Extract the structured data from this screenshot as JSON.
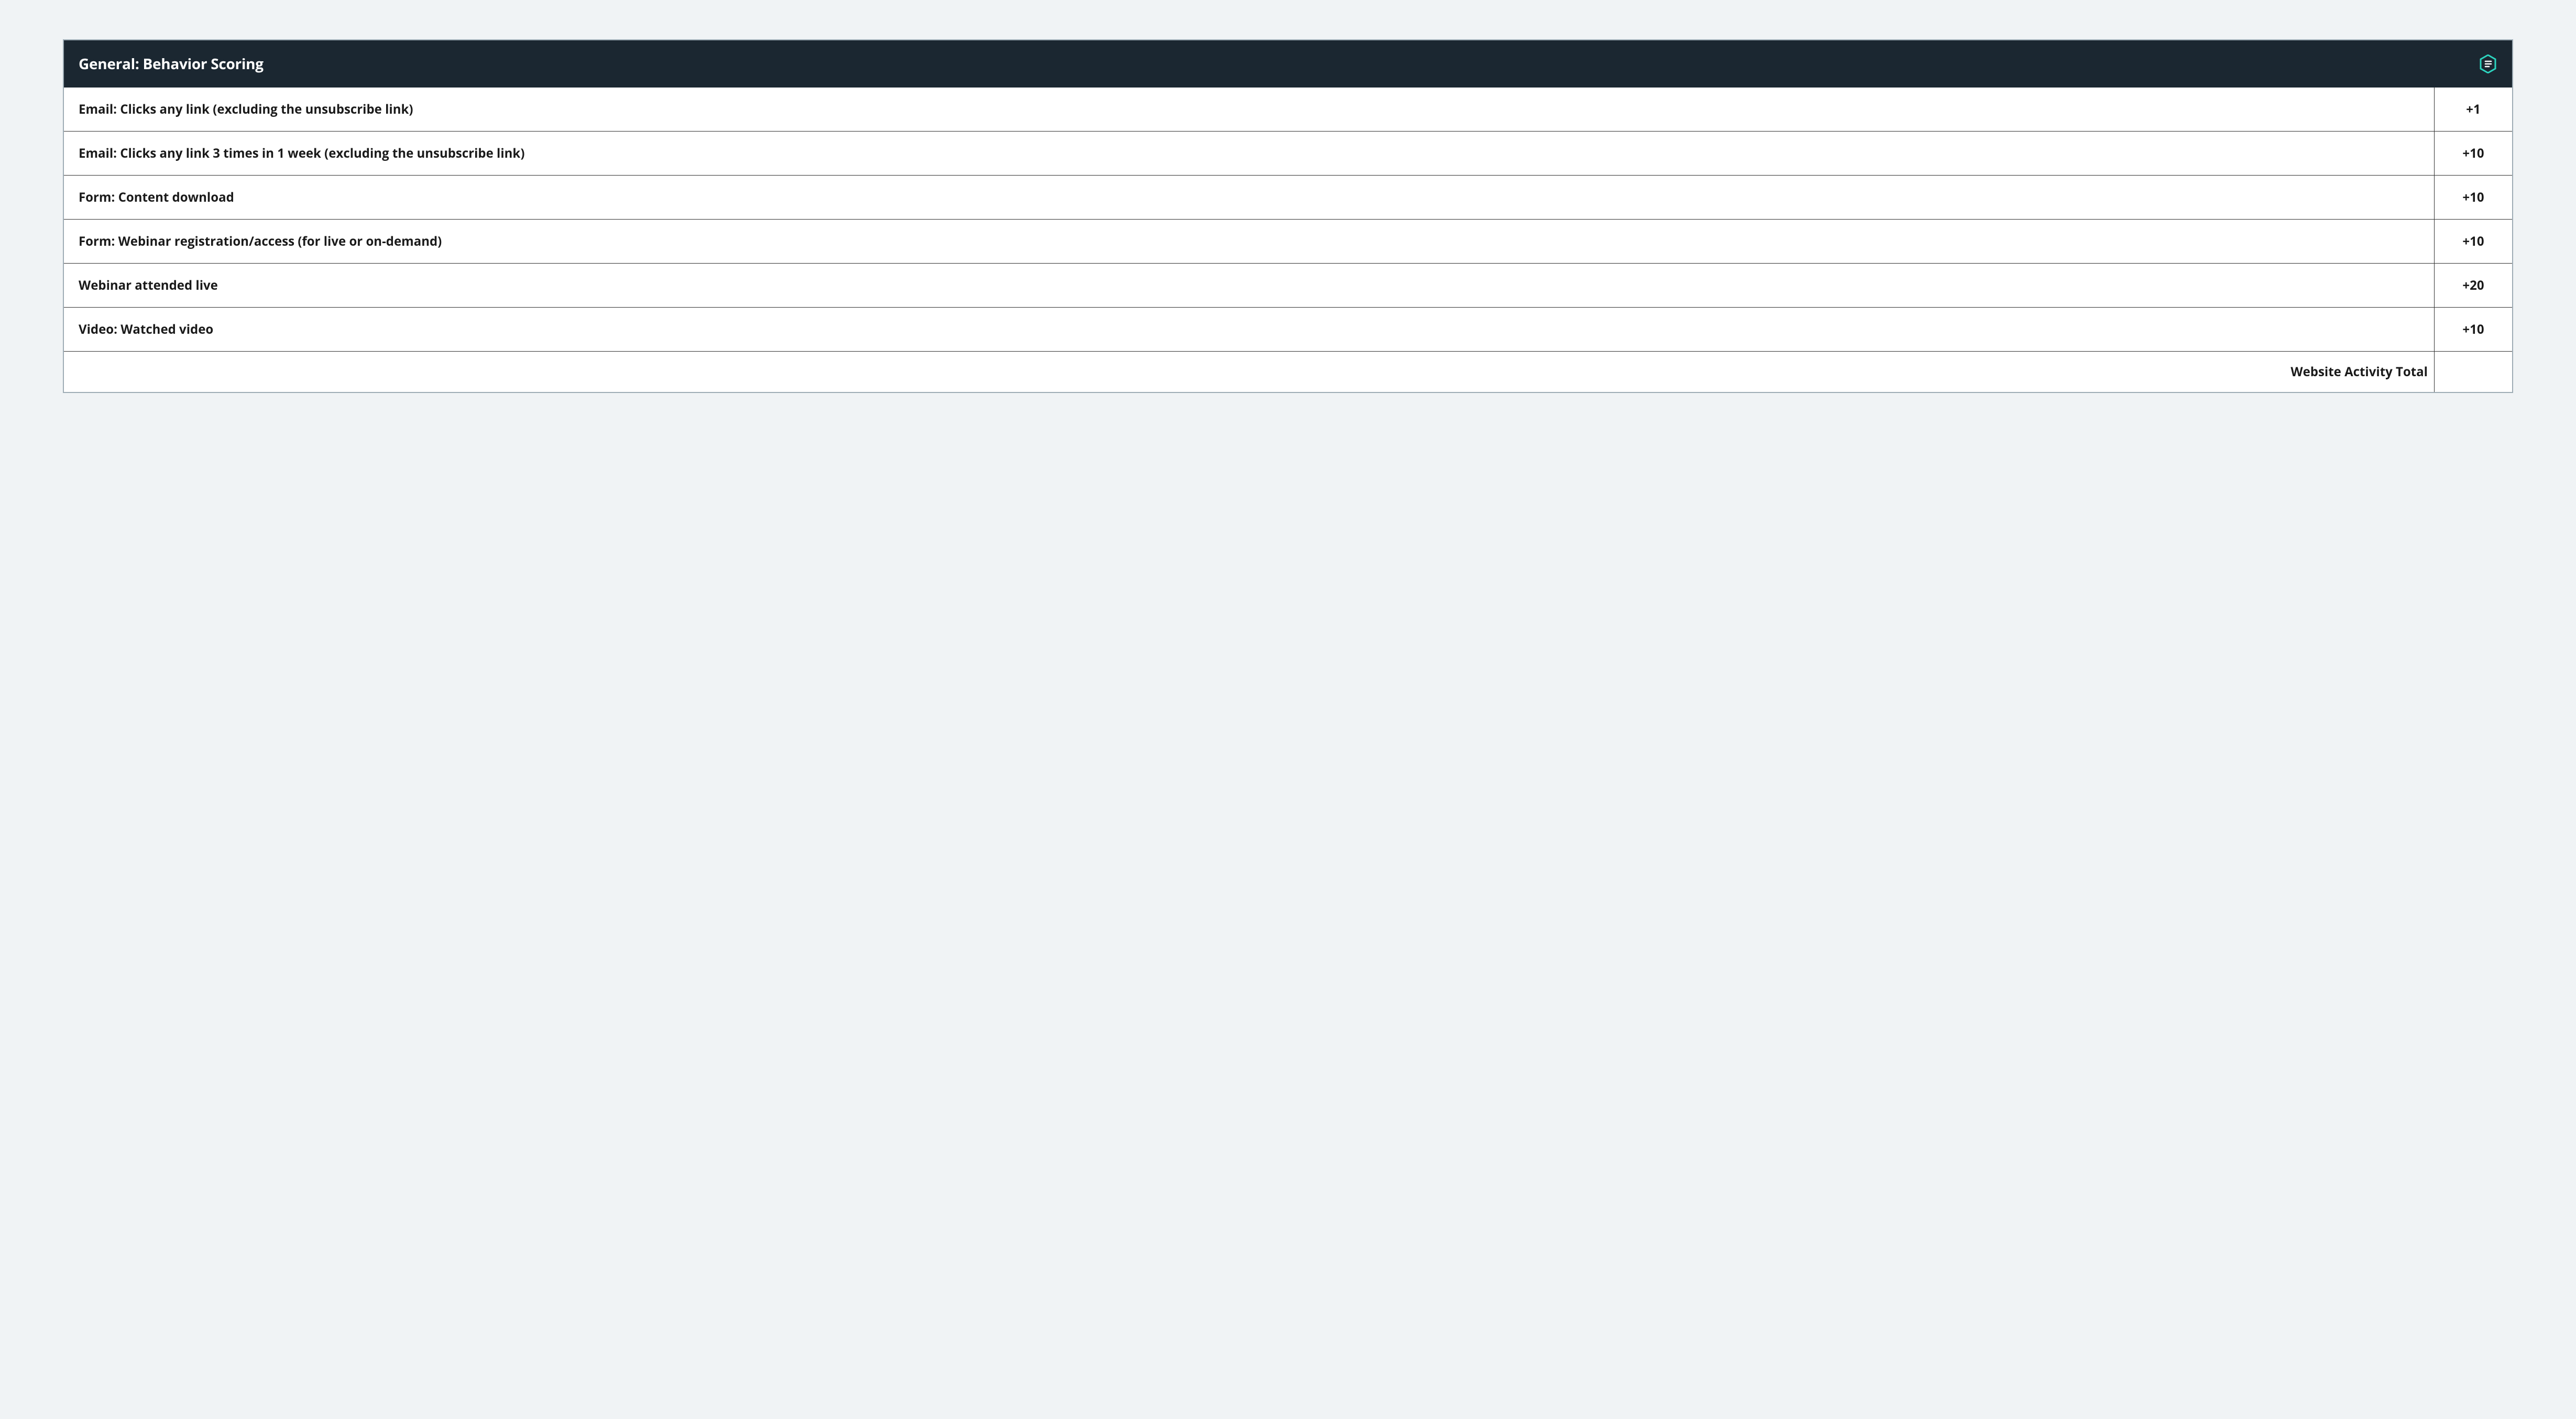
{
  "header": {
    "title": "General: Behavior Scoring"
  },
  "rows": [
    {
      "behavior": "Email: Clicks any link (excluding the unsubscribe link)",
      "score": "+1"
    },
    {
      "behavior": "Email: Clicks any link 3 times in 1 week (excluding the unsubscribe link)",
      "score": "+10"
    },
    {
      "behavior": "Form: Content download",
      "score": "+10"
    },
    {
      "behavior": "Form: Webinar registration/access (for live or on-demand)",
      "score": "+10"
    },
    {
      "behavior": "Webinar attended live",
      "score": "+20"
    },
    {
      "behavior": "Video: Watched video",
      "score": "+10"
    }
  ],
  "total": {
    "label": "Website Activity Total",
    "value": ""
  },
  "colors": {
    "accent": "#2dd4bf",
    "headerBg": "#1b2731",
    "pageBg": "#f0f3f5"
  }
}
